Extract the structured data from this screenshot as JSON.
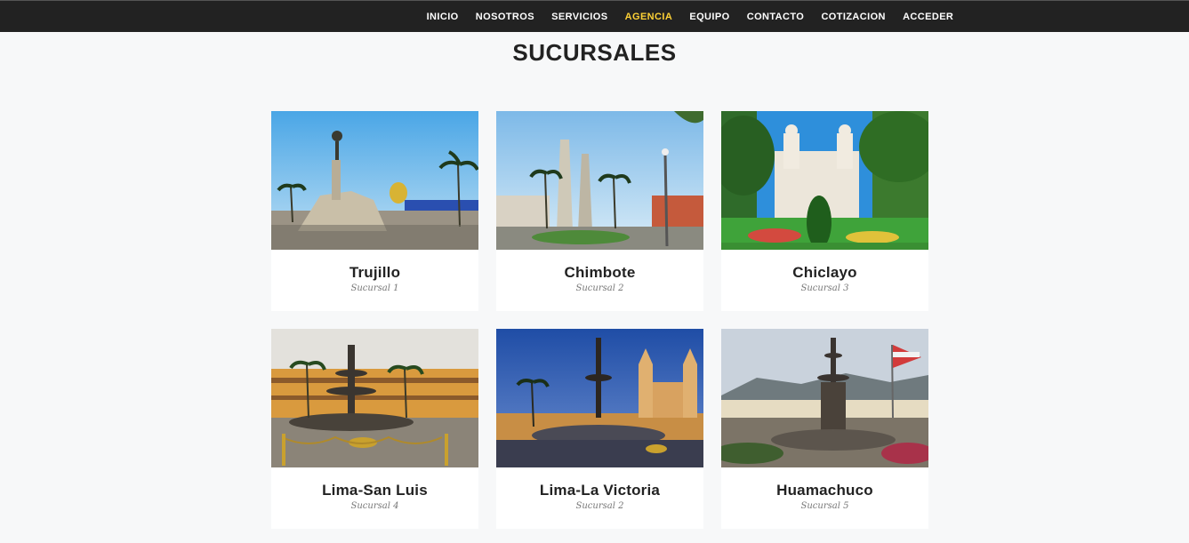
{
  "nav": {
    "items": [
      {
        "label": "INICIO",
        "active": false
      },
      {
        "label": "NOSOTROS",
        "active": false
      },
      {
        "label": "SERVICIOS",
        "active": false
      },
      {
        "label": "AGENCIA",
        "active": true
      },
      {
        "label": "EQUIPO",
        "active": false
      },
      {
        "label": "CONTACTO",
        "active": false
      },
      {
        "label": "COTIZACION",
        "active": false
      },
      {
        "label": "ACCEDER",
        "active": false
      }
    ],
    "active_color": "#fed136"
  },
  "section": {
    "title": "SUCURSALES"
  },
  "branches": [
    {
      "name": "Trujillo",
      "subtitle": "Sucursal 1",
      "photo": "plaza-monument-daytime"
    },
    {
      "name": "Chimbote",
      "subtitle": "Sucursal 2",
      "photo": "plaza-obelisk-palms"
    },
    {
      "name": "Chiclayo",
      "subtitle": "Sucursal 3",
      "photo": "cathedral-garden-palms"
    },
    {
      "name": "Lima-San Luis",
      "subtitle": "Sucursal 4",
      "photo": "plaza-fountain-colonial"
    },
    {
      "name": "Lima-La Victoria",
      "subtitle": "Sucursal 2",
      "photo": "cathedral-night-fountain"
    },
    {
      "name": "Huamachuco",
      "subtitle": "Sucursal 5",
      "photo": "fountain-mountains-flag"
    }
  ]
}
